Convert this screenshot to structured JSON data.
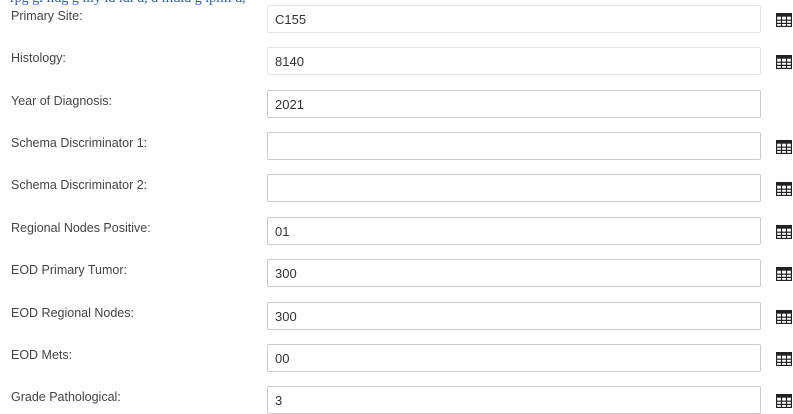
{
  "fields": [
    {
      "label": "Primary Site:",
      "value": "C155",
      "icon": "table-grid-icon"
    },
    {
      "label": "Histology:",
      "value": "8140",
      "icon": "table-grid-icon"
    },
    {
      "label": "Year of Diagnosis:",
      "value": "2021",
      "icon": ""
    },
    {
      "label": "Schema Discriminator 1:",
      "value": "",
      "icon": "table-grid-icon"
    },
    {
      "label": "Schema Discriminator 2:",
      "value": "",
      "icon": "table-grid-icon"
    },
    {
      "label": "Regional Nodes Positive:",
      "value": "01",
      "icon": "table-grid-icon"
    },
    {
      "label": "EOD Primary Tumor:",
      "value": "300",
      "icon": "table-grid-icon"
    },
    {
      "label": "EOD Regional Nodes:",
      "value": "300",
      "icon": "table-grid-icon"
    },
    {
      "label": "EOD Mets:",
      "value": "00",
      "icon": "table-grid-icon"
    },
    {
      "label": "Grade Pathological:",
      "value": "3",
      "icon": "table-grid-icon"
    }
  ]
}
